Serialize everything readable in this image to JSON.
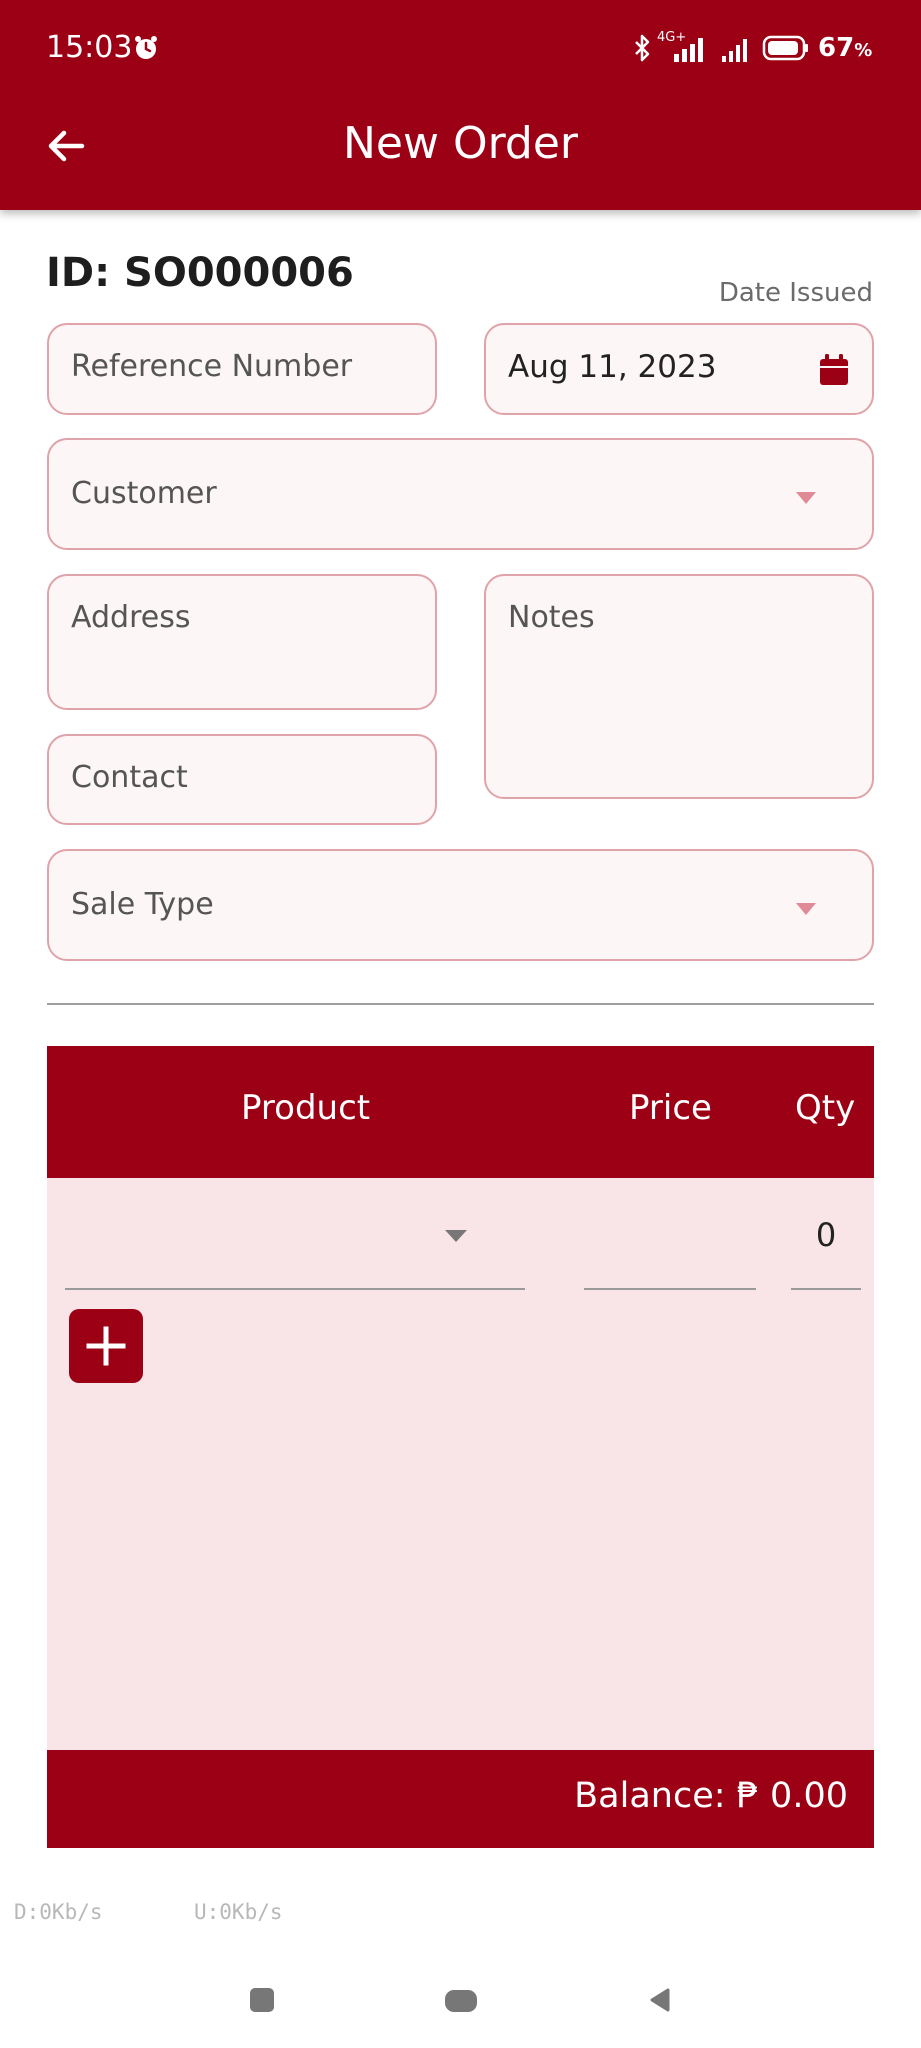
{
  "status_bar": {
    "time": "15:03",
    "network": "4G+",
    "battery_percent": "67",
    "battery_suffix": "%"
  },
  "app_bar": {
    "title": "New Order",
    "back_icon": "arrow-left-icon"
  },
  "form": {
    "order_id": "ID: SO000006",
    "date_label": "Date Issued",
    "reference_placeholder": "Reference Number",
    "date_value": "Aug 11, 2023",
    "customer_placeholder": "Customer",
    "address_placeholder": "Address",
    "notes_placeholder": "Notes",
    "contact_placeholder": "Contact",
    "sale_type_placeholder": "Sale Type"
  },
  "table": {
    "headers": {
      "product": "Product",
      "price": "Price",
      "qty": "Qty"
    },
    "rows": [
      {
        "product": "",
        "price": "",
        "qty": "0"
      }
    ],
    "add_icon": "plus-icon"
  },
  "balance": "Balance: ₱ 0.00",
  "net_speed": {
    "down": "D:0Kb/s",
    "up": "U:0Kb/s"
  },
  "colors": {
    "primary": "#9c0015",
    "field_border": "#e0a3aa",
    "field_bg": "#fdf6f6",
    "table_bg": "#f9e5e7"
  }
}
